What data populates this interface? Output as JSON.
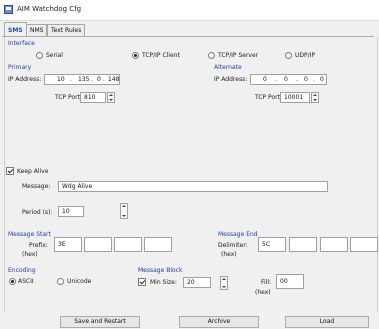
{
  "window": {
    "title": "AIM Watchdog Cfg"
  },
  "tabs": [
    {
      "label": "SMS",
      "active": true
    },
    {
      "label": "NMS",
      "active": false
    },
    {
      "label": "Text Rules",
      "active": false
    }
  ],
  "interface": {
    "group_label": "Interface",
    "options": [
      {
        "label": "Serial",
        "selected": false
      },
      {
        "label": "TCP/IP Client",
        "selected": true
      },
      {
        "label": "TCP/IP Server",
        "selected": false
      },
      {
        "label": "UDP/IP",
        "selected": false
      }
    ],
    "primary": {
      "label": "Primary",
      "ip_label": "IP Address:",
      "ip": [
        "10",
        "135",
        "0",
        "148"
      ],
      "port_label": "TCP Port:",
      "port": "810"
    },
    "alternate": {
      "label": "Alternate",
      "ip_label": "IP Address:",
      "ip": [
        "0",
        "0",
        "0",
        "0"
      ],
      "port_label": "TCP Port:",
      "port": "10001"
    }
  },
  "keep_alive": {
    "label": "Keep Alive",
    "checked": true,
    "message_label": "Message:",
    "message": "Wdg Alive",
    "period_label": "Period (s):",
    "period": "10"
  },
  "message_start": {
    "group_label": "Message Start",
    "prefix_label": "Prefix:",
    "hex_label": "(hex)",
    "values": [
      "3E",
      "",
      "",
      ""
    ]
  },
  "message_end": {
    "group_label": "Message End",
    "delimiter_label": "Delimiter:",
    "hex_label": "(hex)",
    "values": [
      "5C",
      "",
      "",
      ""
    ]
  },
  "encoding": {
    "group_label": "Encoding",
    "options": [
      {
        "label": "ASCII",
        "selected": true
      },
      {
        "label": "Unicode",
        "selected": false
      }
    ]
  },
  "message_block": {
    "group_label": "Message Block",
    "min_size_label": "Min Size:",
    "min_size_checked": true,
    "min_size": "20",
    "fill_label": "Fill:",
    "fill_hex_label": "(hex)",
    "fill": "00"
  },
  "buttons": {
    "save_restart": "Save and Restart",
    "archive": "Archive",
    "load": "Load"
  }
}
